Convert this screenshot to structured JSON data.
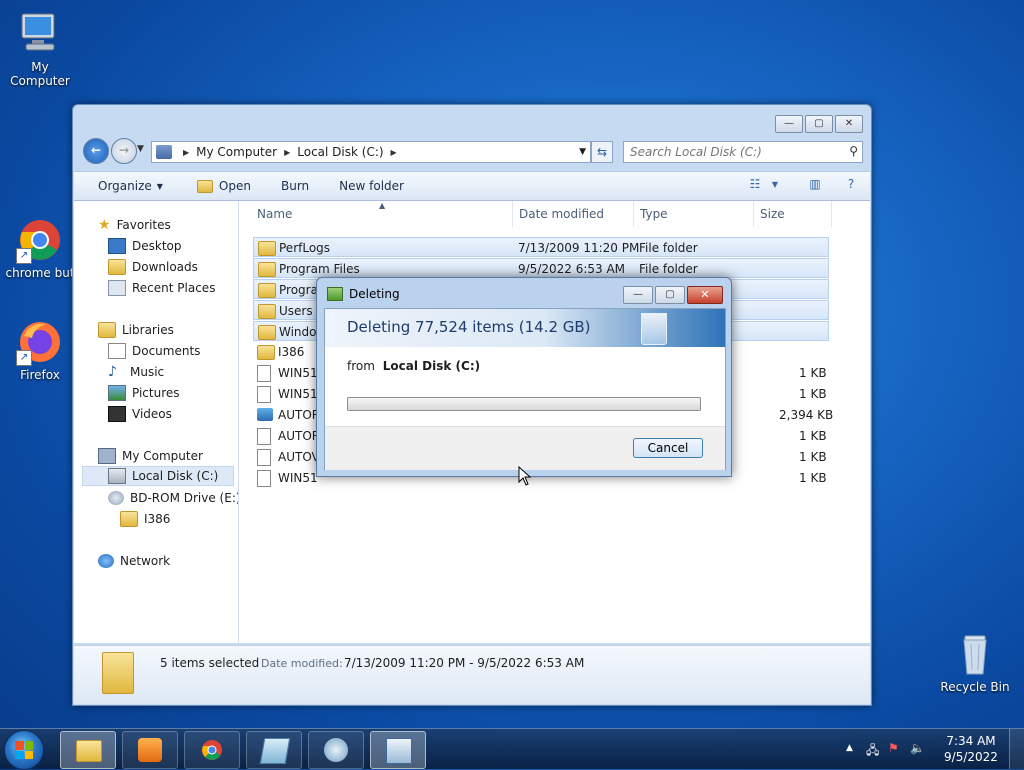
{
  "desktop": {
    "icons": [
      {
        "label": "My Computer"
      },
      {
        "label": "chrome but"
      },
      {
        "label": "Firefox"
      },
      {
        "label": "Recycle Bin"
      }
    ]
  },
  "explorer": {
    "address": {
      "crumbs": [
        "My Computer",
        "Local Disk (C:)"
      ]
    },
    "search": {
      "placeholder": "Search Local Disk (C:)"
    },
    "toolbar": {
      "organize": "Organize",
      "open": "Open",
      "burn": "Burn",
      "new_folder": "New folder"
    },
    "nav": {
      "favorites": "Favorites",
      "desktop": "Desktop",
      "downloads": "Downloads",
      "recent": "Recent Places",
      "libraries": "Libraries",
      "documents": "Documents",
      "music": "Music",
      "pictures": "Pictures",
      "videos": "Videos",
      "my_computer": "My Computer",
      "local_disk": "Local Disk (C:)",
      "bd_rom": "BD-ROM Drive (E:) S",
      "i386": "I386",
      "network": "Network"
    },
    "columns": {
      "name": "Name",
      "date": "Date modified",
      "type": "Type",
      "size": "Size"
    },
    "rows": [
      {
        "name": "PerfLogs",
        "date": "7/13/2009 11:20 PM",
        "type": "File folder",
        "size": ""
      },
      {
        "name": "Program Files",
        "date": "9/5/2022 6:53 AM",
        "type": "File folder",
        "size": ""
      },
      {
        "name": "Program",
        "date": "",
        "type": "",
        "size": ""
      },
      {
        "name": "Users",
        "date": "",
        "type": "",
        "size": ""
      },
      {
        "name": "Window",
        "date": "",
        "type": "",
        "size": ""
      },
      {
        "name": "I386",
        "date": "",
        "type": "",
        "size": ""
      },
      {
        "name": "WIN511",
        "date": "",
        "type": "",
        "size": "1 KB"
      },
      {
        "name": "WIN511",
        "date": "",
        "type": "",
        "size": "1 KB"
      },
      {
        "name": "AUTOR",
        "date": "",
        "type": "",
        "size": "2,394 KB"
      },
      {
        "name": "AUTOR",
        "date": "",
        "type": "",
        "size": "1 KB"
      },
      {
        "name": "AUTOV",
        "date": "",
        "type": "",
        "size": "1 KB"
      },
      {
        "name": "WIN51",
        "date": "",
        "type": "",
        "size": "1 KB"
      }
    ],
    "status": {
      "count": "5 items selected",
      "date_label": "Date modified:",
      "date_range": "7/13/2009 11:20 PM - 9/5/2022 6:53 AM"
    }
  },
  "dialog": {
    "title": "Deleting",
    "heading": "Deleting 77,524 items (14.2 GB)",
    "from_prefix": "from",
    "from_location": "Local Disk (C:)",
    "progress": 0,
    "cancel": "Cancel"
  },
  "taskbar": {
    "clock_time": "7:34 AM",
    "clock_date": "9/5/2022"
  },
  "colors": {
    "desktop_blue": "#1766c4",
    "selection": "#d7e6f8",
    "dialog_frame": "#bad2ee"
  }
}
